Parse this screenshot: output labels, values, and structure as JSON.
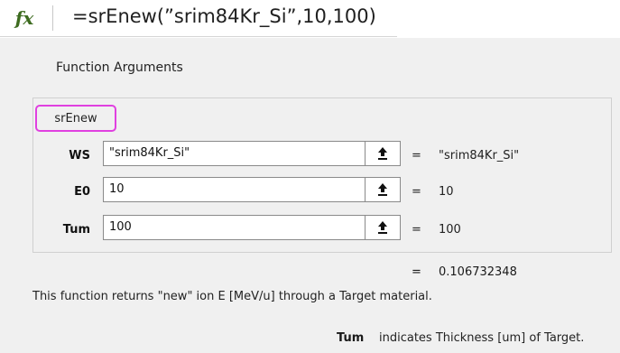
{
  "formula_bar": {
    "fx_label": "fx",
    "formula": "=srEnew(”srim84Kr_Si”,10,100)"
  },
  "dialog": {
    "title": "Function Arguments",
    "function_name": "srEnew",
    "arguments": [
      {
        "name": "WS",
        "value": "\"srim84Kr_Si\"",
        "eq": "=",
        "result": "\"srim84Kr_Si\""
      },
      {
        "name": "E0",
        "value": "10",
        "eq": "=",
        "result": "10"
      },
      {
        "name": "Tum",
        "value": "100",
        "eq": "=",
        "result": "100"
      }
    ],
    "result_eq": "=",
    "result": "0.106732348",
    "description": "This function returns \"new\" ion E [MeV/u] through a Target material.",
    "arg_help_name": "Tum",
    "arg_help_text": "indicates Thickness [um] of Target."
  },
  "icons": {
    "fx": "insert-function-icon",
    "ref": "collapse-dialog-arrow-icon"
  },
  "colors": {
    "highlight_border": "#e040e0",
    "fx_green": "#3d6b1f",
    "dialog_bg": "#f0f0f0"
  }
}
